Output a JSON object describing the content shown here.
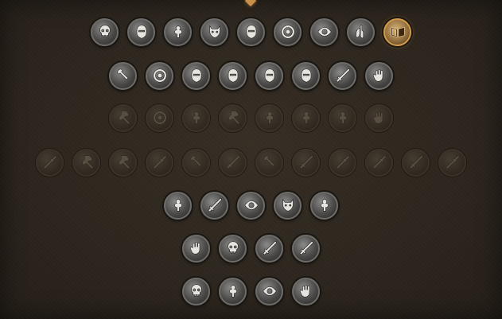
{
  "perk_tree": {
    "rows": [
      {
        "state": "unlocked",
        "perks": [
          {
            "icon": "skull-icon"
          },
          {
            "icon": "helmet-icon"
          },
          {
            "icon": "muscle-icon"
          },
          {
            "icon": "wolf-icon"
          },
          {
            "icon": "warrior-icon"
          },
          {
            "icon": "swirl-icon"
          },
          {
            "icon": "eye-icon"
          },
          {
            "icon": "lungs-icon"
          },
          {
            "icon": "book-icon",
            "state": "selected"
          }
        ]
      },
      {
        "state": "unlocked",
        "perks": [
          {
            "icon": "axe-icon"
          },
          {
            "icon": "shield-bash-icon"
          },
          {
            "icon": "masked-face-icon"
          },
          {
            "icon": "bald-head-icon"
          },
          {
            "icon": "scream-icon"
          },
          {
            "icon": "knight-helm-icon"
          },
          {
            "icon": "crossed-blades-icon"
          },
          {
            "icon": "hand-orb-icon"
          }
        ]
      },
      {
        "state": "locked",
        "perks": [
          {
            "icon": "hammer-icon"
          },
          {
            "icon": "parry-icon"
          },
          {
            "icon": "bomb-icon"
          },
          {
            "icon": "anvil-icon"
          },
          {
            "icon": "kick-icon"
          },
          {
            "icon": "clover-icon"
          },
          {
            "icon": "horn-icon"
          },
          {
            "icon": "fist-icon"
          }
        ]
      },
      {
        "state": "locked",
        "perks": [
          {
            "icon": "spear-icon"
          },
          {
            "icon": "flail-icon"
          },
          {
            "icon": "mace-icon"
          },
          {
            "icon": "halberd-icon"
          },
          {
            "icon": "cleaver-icon"
          },
          {
            "icon": "dagger-icon"
          },
          {
            "icon": "throwing-axes-icon"
          },
          {
            "icon": "sword-icon"
          },
          {
            "icon": "polearm-icon"
          },
          {
            "icon": "arrows-icon"
          },
          {
            "icon": "throwing-knives-icon"
          },
          {
            "icon": "crossbow-icon"
          }
        ]
      },
      {
        "state": "locked",
        "perks": [
          {
            "icon": "boot-icon",
            "state": "unlocked"
          },
          {
            "icon": "blade-rush-icon",
            "state": "unlocked"
          },
          {
            "icon": "beast-eye-icon",
            "state": "unlocked"
          },
          {
            "icon": "dog-icon",
            "state": "unlocked"
          },
          {
            "icon": "footprints-icon",
            "state": "unlocked"
          }
        ]
      },
      {
        "state": "locked",
        "perks": [
          {
            "icon": "bandaged-hand-icon",
            "state": "unlocked"
          },
          {
            "icon": "skull-crossbones-icon",
            "state": "unlocked"
          },
          {
            "icon": "twin-daggers-icon",
            "state": "unlocked"
          },
          {
            "icon": "heavy-blade-icon",
            "state": "unlocked"
          }
        ]
      },
      {
        "state": "locked",
        "perks": [
          {
            "icon": "death-skull-icon",
            "state": "unlocked"
          },
          {
            "icon": "armor-piece-icon",
            "state": "unlocked"
          },
          {
            "icon": "eyepatch-icon",
            "state": "unlocked"
          },
          {
            "icon": "iron-fist-icon",
            "state": "unlocked"
          }
        ]
      }
    ]
  }
}
